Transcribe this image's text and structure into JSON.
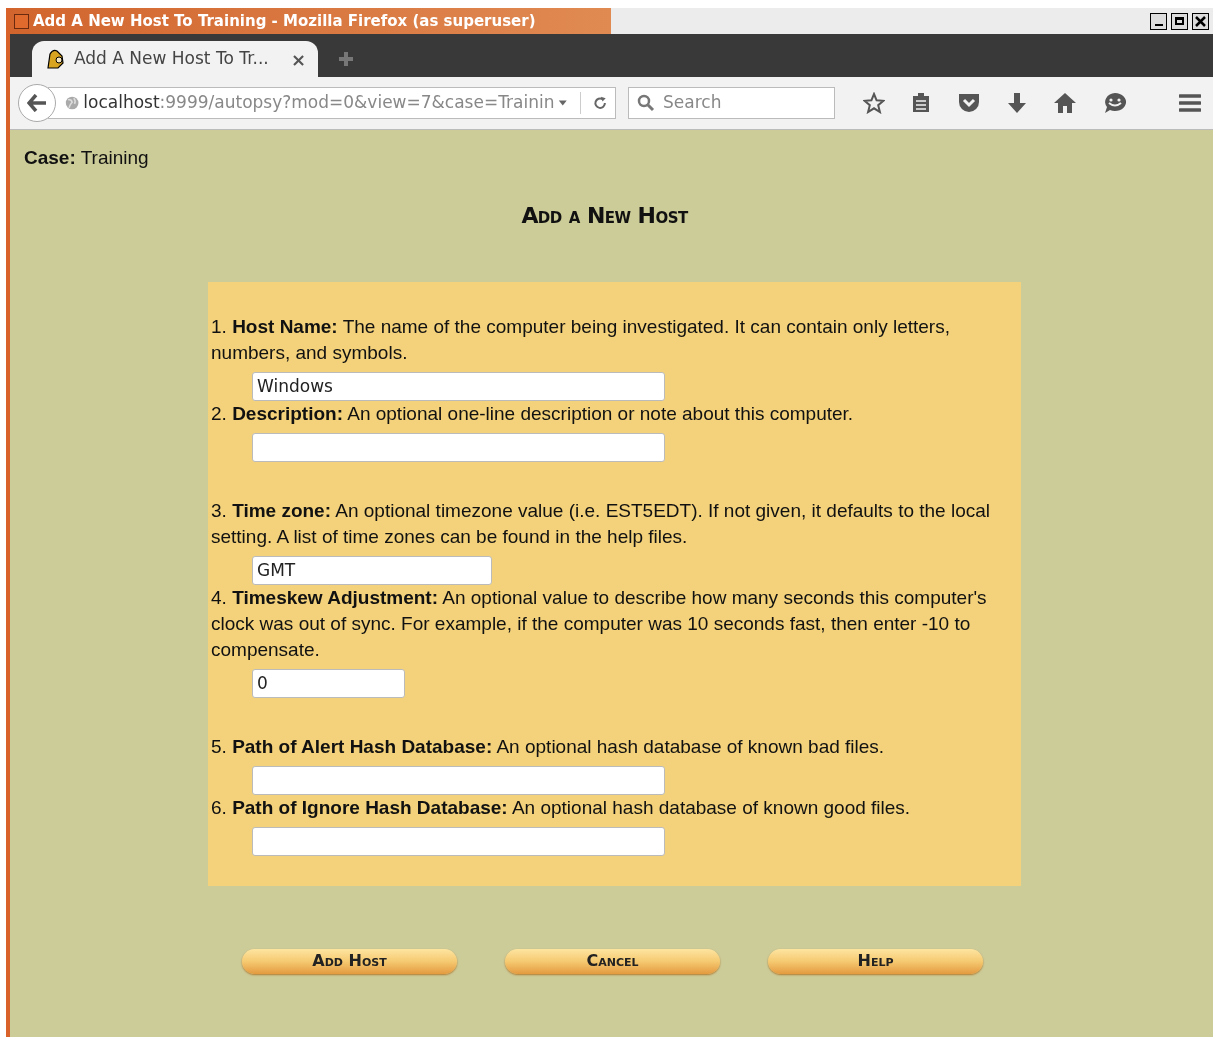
{
  "window": {
    "title": "Add A New Host To Training - Mozilla Firefox (as superuser)"
  },
  "tabs": [
    {
      "label": "Add A New Host To Tr...",
      "selected": true,
      "close": "×"
    }
  ],
  "address_bar": {
    "host": "localhost",
    "rest": ":9999/autopsy?mod=0&view=7&case=Trainin"
  },
  "search": {
    "placeholder": "Search"
  },
  "case": {
    "label": "Case:",
    "value": "Training"
  },
  "heading": "Add a New Host",
  "fields": [
    {
      "text": "1. **Host Name:** The name of the computer being investigated. It can contain only letters, numbers, and symbols.",
      "value": "Windows"
    },
    {
      "text": "2. **Description:** An optional one-line description or note about this computer."
    },
    {
      "text": "3. **Time zone:** An optional timezone value (i.e. EST5EDT). If not given, it defaults to the local setting. A list of time zones can be found in the help files.",
      "value": "GMT"
    },
    {
      "text": "4. **Timeskew Adjustment:** An optional value to describe how many seconds this computer's clock was out of sync. For example, if the computer was 10 seconds fast, then enter -10 to compensate.",
      "value": "0"
    },
    {
      "text": "5. **Path of Alert Hash Database:** An optional hash database of known bad files."
    },
    {
      "text": "6. **Path of Ignore Hash Database:** An optional hash database of known good files."
    }
  ],
  "buttons": [
    "Add Host",
    "Cancel",
    "Help"
  ]
}
